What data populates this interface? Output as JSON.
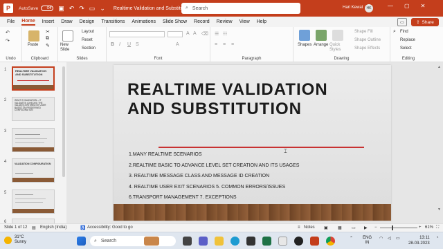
{
  "titlebar": {
    "autosave_label": "AutoSave",
    "autosave_state": "Off",
    "document_title": "Realtime Validation and Substitution • Saved to this PC",
    "search_placeholder": "Search",
    "user_name": "Hari Kewat",
    "user_initials": "HK"
  },
  "menu": {
    "tabs": [
      "File",
      "Home",
      "Insert",
      "Draw",
      "Design",
      "Transitions",
      "Animations",
      "Slide Show",
      "Record",
      "Review",
      "View",
      "Help"
    ],
    "active": "Home",
    "share_label": "Share"
  },
  "ribbon": {
    "groups": {
      "undo": "Undo",
      "clipboard": "Clipboard",
      "slides": "Slides",
      "font": "Font",
      "paragraph": "Paragraph",
      "drawing": "Drawing",
      "editing": "Editing"
    },
    "paste": "Paste",
    "new_slide": "New Slide",
    "layout": "Layout",
    "reset": "Reset",
    "section": "Section",
    "shapes": "Shapes",
    "arrange": "Arrange",
    "quick_styles": "Quick Styles",
    "shape_fill": "Shape Fill",
    "shape_outline": "Shape Outline",
    "shape_effects": "Shape Effects",
    "find": "Find",
    "replace": "Replace",
    "select": "Select"
  },
  "thumbnails": [
    {
      "num": "1",
      "text": "REALTIME VALIDATION AND SUBSTITUTION",
      "active": true
    },
    {
      "num": "2",
      "text": "WHAT IS VALIDATION – IT VALIDATES (CHECKS) THE VALUE(S) ENTERED BY USER BASED ON PREDEFINED CONFIGURATION",
      "active": false
    },
    {
      "num": "3",
      "text": "",
      "active": false
    },
    {
      "num": "4",
      "text": "VALIDATION CONFIGURATION",
      "active": false
    },
    {
      "num": "5",
      "text": "",
      "active": false
    },
    {
      "num": "6",
      "text": "",
      "active": false
    }
  ],
  "slide": {
    "title_line1": "REALTIME VALIDATION",
    "title_line2": "AND SUBSTITUTION",
    "bullets": [
      "1.MANY REALTIME SCENARIOS",
      "2.REALTIME BASIC TO ADVANCE LEVEL SET CREATION AND ITS USAGES",
      "3. REALTIME MESSAGE CLASS AND MESSAGE ID CREATION",
      "4. REALTIME USER EXIT SCENARIOS 5. COMMON ERRORS/ISSUES",
      "6.TRANSPORT MANAGEMENT 7. EXCEPTIONS"
    ]
  },
  "statusbar": {
    "slide_counter": "Slide 1 of 12",
    "language": "English (India)",
    "accessibility": "Accessibility: Good to go",
    "notes": "Notes",
    "zoom": "61%"
  },
  "taskbar": {
    "temperature": "31°C",
    "weather": "Sunny",
    "search_placeholder": "Search",
    "lang_top": "ENG",
    "lang_bottom": "IN",
    "time": "13:11",
    "date": "28-03-2023"
  },
  "colors": {
    "accent": "#c43e1c",
    "title_line": "#c83232"
  }
}
